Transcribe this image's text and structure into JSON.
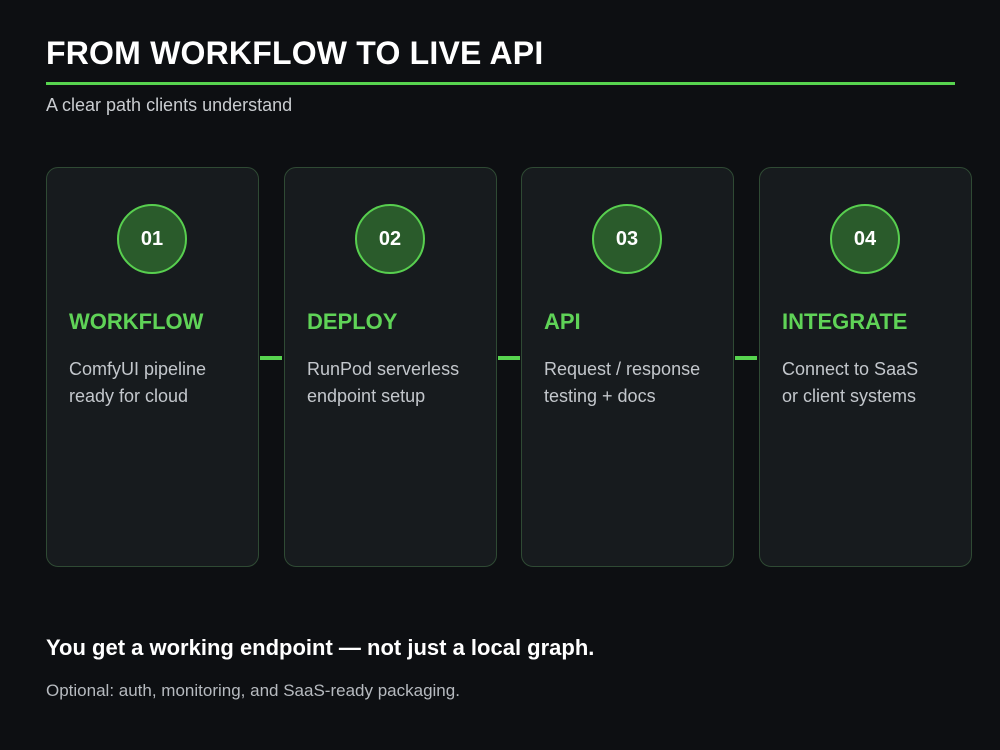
{
  "header": {
    "title": "FROM WORKFLOW TO LIVE API",
    "subtitle": "A clear path clients understand"
  },
  "steps": [
    {
      "number": "01",
      "title": "WORKFLOW",
      "desc_line1": "ComfyUI pipeline",
      "desc_line2": "ready for cloud"
    },
    {
      "number": "02",
      "title": "DEPLOY",
      "desc_line1": "RunPod serverless",
      "desc_line2": "endpoint setup"
    },
    {
      "number": "03",
      "title": "API",
      "desc_line1": "Request / response",
      "desc_line2": "testing + docs"
    },
    {
      "number": "04",
      "title": "INTEGRATE",
      "desc_line1": "Connect to SaaS",
      "desc_line2": "or client systems"
    }
  ],
  "footer": {
    "headline": "You get a working endpoint — not just a local graph.",
    "note": "Optional: auth, monitoring, and SaaS-ready packaging."
  },
  "colors": {
    "background": "#0d0f12",
    "accent": "#57d44f",
    "card": "#171b1e",
    "badge_fill": "#2a5b2b"
  }
}
